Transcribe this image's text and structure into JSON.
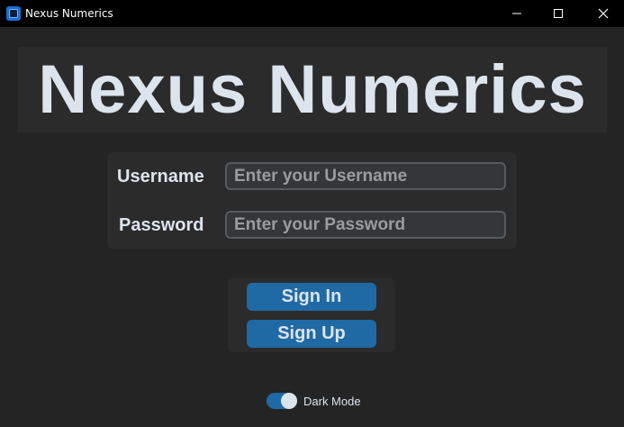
{
  "window": {
    "title": "Nexus Numerics"
  },
  "banner": {
    "title": "Nexus Numerics"
  },
  "login": {
    "username_label": "Username",
    "username_placeholder": "Enter your Username",
    "username_value": "",
    "password_label": "Password",
    "password_placeholder": "Enter your Password",
    "password_value": ""
  },
  "buttons": {
    "sign_in": "Sign In",
    "sign_up": "Sign Up"
  },
  "appearance": {
    "dark_mode_label": "Dark Mode",
    "dark_mode_on": true
  },
  "icons": {
    "app": "app-icon",
    "minimize": "minimize-icon",
    "maximize": "maximize-icon",
    "close": "close-icon"
  },
  "colors": {
    "background": "#242424",
    "panel": "#2b2b2b",
    "accent": "#1f6aa5",
    "text": "#dce4ee",
    "input_bg": "#343638",
    "input_border": "#565b5e"
  }
}
